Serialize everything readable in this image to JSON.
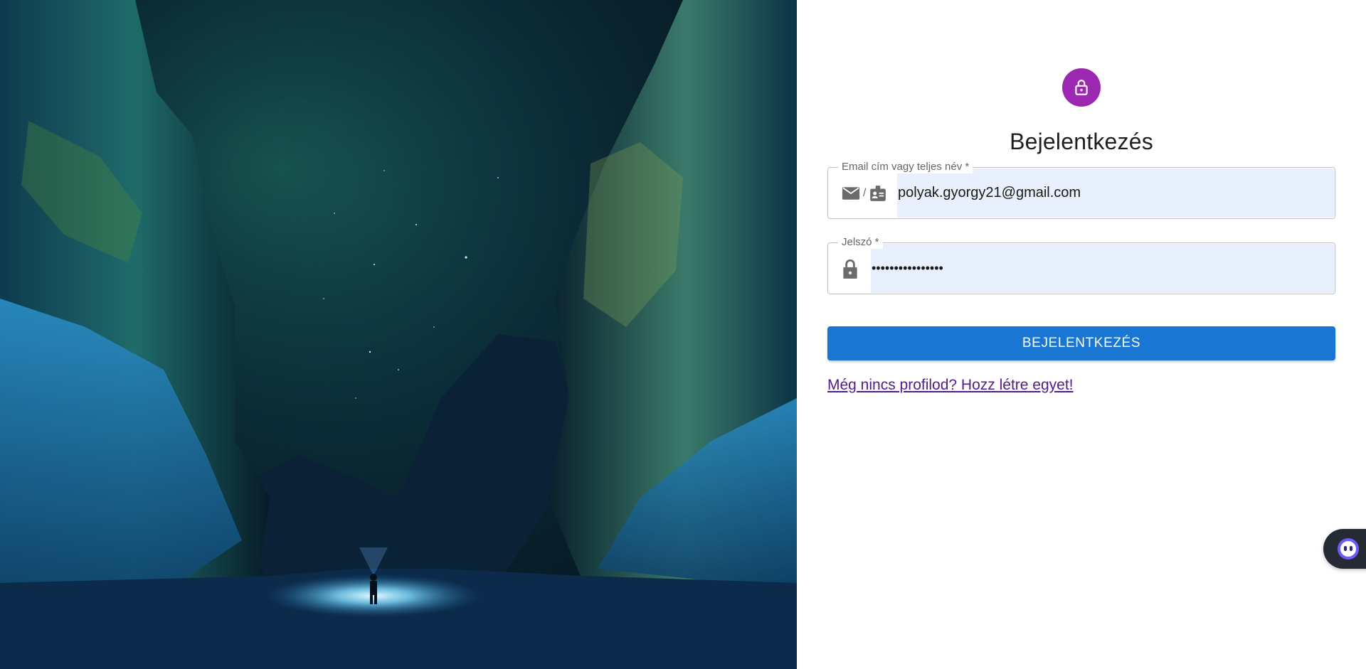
{
  "hero": {
    "image_icon": "night-canyon-aurora-image"
  },
  "login": {
    "avatar_icon": "lock-open-icon",
    "title": "Bejelentkezés",
    "email_field": {
      "label": "Email cím vagy teljes név *",
      "value": "polyak.gyorgy21@gmail.com",
      "icons": [
        "mail-icon",
        "contact-card-icon"
      ],
      "separator": "/"
    },
    "password_field": {
      "label": "Jelszó *",
      "value": "••••••••••••••••",
      "icon": "lock-icon"
    },
    "submit_label": "BEJELENTKEZÉS",
    "register_link": "Még nincs profilod? Hozz létre egyet!"
  },
  "assistant": {
    "icon": "assistant-bot-icon"
  },
  "colors": {
    "avatar": "#9c27b0",
    "primary_button": "#1976d2",
    "autofill": "#e8f0fe",
    "link_visited": "#551a8b"
  }
}
